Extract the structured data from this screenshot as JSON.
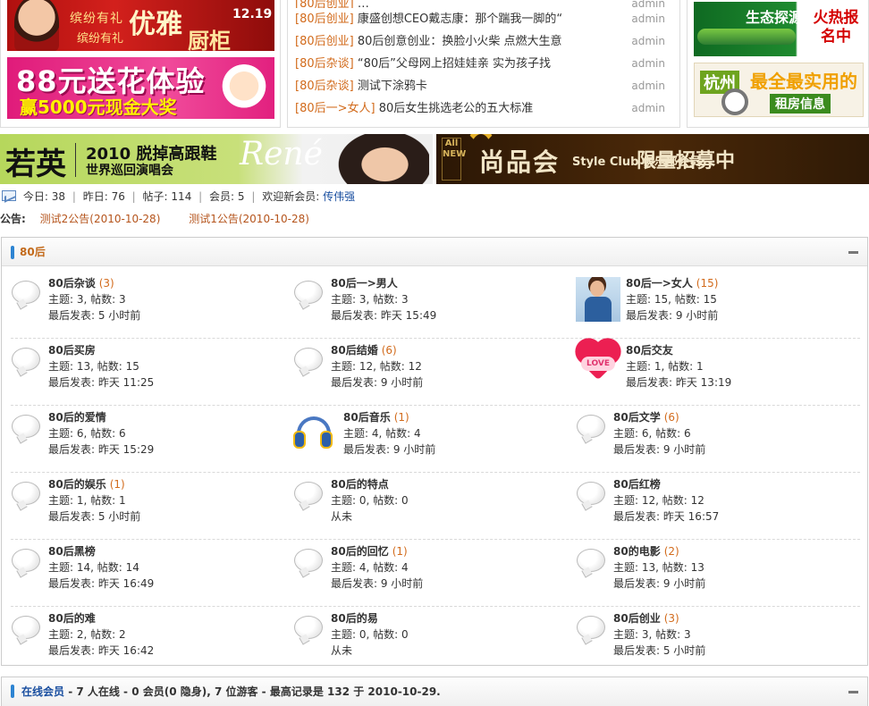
{
  "ads": {
    "left_top": {
      "line1": "缤纷有礼",
      "line2": "优雅",
      "line3": "缤纷有礼",
      "line4": "厨柜",
      "date": "12.19"
    },
    "left_bottom": {
      "line1": "88元送花体验",
      "line2": "赢5000元现金大奖"
    },
    "right_top": {
      "line1": "生态探源",
      "line2": "火热报名中"
    },
    "right_bottom": {
      "city": "杭州",
      "line1": "最全最实用的",
      "line2": "租房信息"
    }
  },
  "news": [
    {
      "category": "[80后创业]",
      "title": "…",
      "author": "admin"
    },
    {
      "category": "[80后创业]",
      "title": "康盛创想CEO戴志康：那个踹我一脚的“",
      "author": "admin"
    },
    {
      "category": "[80后创业]",
      "title": "80后创意创业：换脸小火柴 点燃大生意",
      "author": "admin"
    },
    {
      "category": "[80后杂谈]",
      "title": "“80后”父母网上招娃娃亲 实为孩子找",
      "author": "admin"
    },
    {
      "category": "[80后杂谈]",
      "title": "测试下涂鸦卡",
      "author": "admin"
    },
    {
      "category": "[80后一>女人]",
      "title": "80后女生挑选老公的五大标准",
      "author": "admin"
    }
  ],
  "banners": {
    "left": {
      "brand": "若英",
      "line1": "2010 脱掉高跟鞋",
      "line2": "世界巡回演唱会",
      "logo": "René"
    },
    "right": {
      "badge": "All NEW",
      "line1": "尚品会",
      "line2": "Style Club 俱乐部会员",
      "line3": "限量招募中"
    }
  },
  "stats": {
    "today_label": "今日:",
    "today": "38",
    "yesterday_label": "昨日:",
    "yesterday": "76",
    "posts_label": "帖子:",
    "posts": "114",
    "members_label": "会员:",
    "members": "5",
    "welcome_label": "欢迎新会员:",
    "new_member": "传伟强"
  },
  "notice": {
    "label": "公告:",
    "items": [
      "测试2公告(2010-10-28)",
      "测试1公告(2010-10-28)"
    ]
  },
  "forum": {
    "title": "80后",
    "rows": [
      [
        {
          "name": "80后杂谈",
          "count": "(3)",
          "topics": "主题: 3, 帖数: 3",
          "last": "最后发表: 5 小时前"
        },
        {
          "name": "80后一>男人",
          "count": "",
          "topics": "主题: 3, 帖数: 3",
          "last": "最后发表: 昨天 15:49"
        },
        {
          "name": "80后一>女人",
          "count": "(15)",
          "topics": "主题: 15, 帖数: 15",
          "last": "最后发表: 9 小时前"
        }
      ],
      [
        {
          "name": "80后买房",
          "count": "",
          "topics": "主题: 13, 帖数: 15",
          "last": "最后发表: 昨天 11:25"
        },
        {
          "name": "80后结婚",
          "count": "(6)",
          "topics": "主题: 12, 帖数: 12",
          "last": "最后发表: 9 小时前"
        },
        {
          "name": "80后交友",
          "count": "",
          "topics": "主题: 1, 帖数: 1",
          "last": "最后发表: 昨天 13:19"
        }
      ],
      [
        {
          "name": "80后的爱情",
          "count": "",
          "topics": "主题: 6, 帖数: 6",
          "last": "最后发表: 昨天 15:29"
        },
        {
          "name": "80后音乐",
          "count": "(1)",
          "topics": "主题: 4, 帖数: 4",
          "last": "最后发表: 9 小时前"
        },
        {
          "name": "80后文学",
          "count": "(6)",
          "topics": "主题: 6, 帖数: 6",
          "last": "最后发表: 9 小时前"
        }
      ],
      [
        {
          "name": "80后的娱乐",
          "count": "(1)",
          "topics": "主题: 1, 帖数: 1",
          "last": "最后发表: 5 小时前"
        },
        {
          "name": "80后的特点",
          "count": "",
          "topics": "主题: 0, 帖数: 0",
          "last": "从未"
        },
        {
          "name": "80后红榜",
          "count": "",
          "topics": "主题: 12, 帖数: 12",
          "last": "最后发表: 昨天 16:57"
        }
      ],
      [
        {
          "name": "80后黑榜",
          "count": "",
          "topics": "主题: 14, 帖数: 14",
          "last": "最后发表: 昨天 16:49"
        },
        {
          "name": "80后的回忆",
          "count": "(1)",
          "topics": "主题: 4, 帖数: 4",
          "last": "最后发表: 9 小时前"
        },
        {
          "name": "80的电影",
          "count": "(2)",
          "topics": "主题: 13, 帖数: 13",
          "last": "最后发表: 9 小时前"
        }
      ],
      [
        {
          "name": "80后的难",
          "count": "",
          "topics": "主题: 2, 帖数: 2",
          "last": "最后发表: 昨天 16:42"
        },
        {
          "name": "80后的易",
          "count": "",
          "topics": "主题: 0, 帖数: 0",
          "last": "从未"
        },
        {
          "name": "80后创业",
          "count": "(3)",
          "topics": "主题: 3, 帖数: 3",
          "last": "最后发表: 5 小时前"
        }
      ]
    ]
  },
  "online": {
    "title": "在线会员",
    "summary": " - 7 人在线  - 0 会员(0 隐身), 7 位游客  - 最高记录是  132 于  2010-10-29."
  },
  "colors": {
    "accent": "#2d84d2",
    "category": "#d26b1c",
    "link": "#1a4fa0"
  }
}
